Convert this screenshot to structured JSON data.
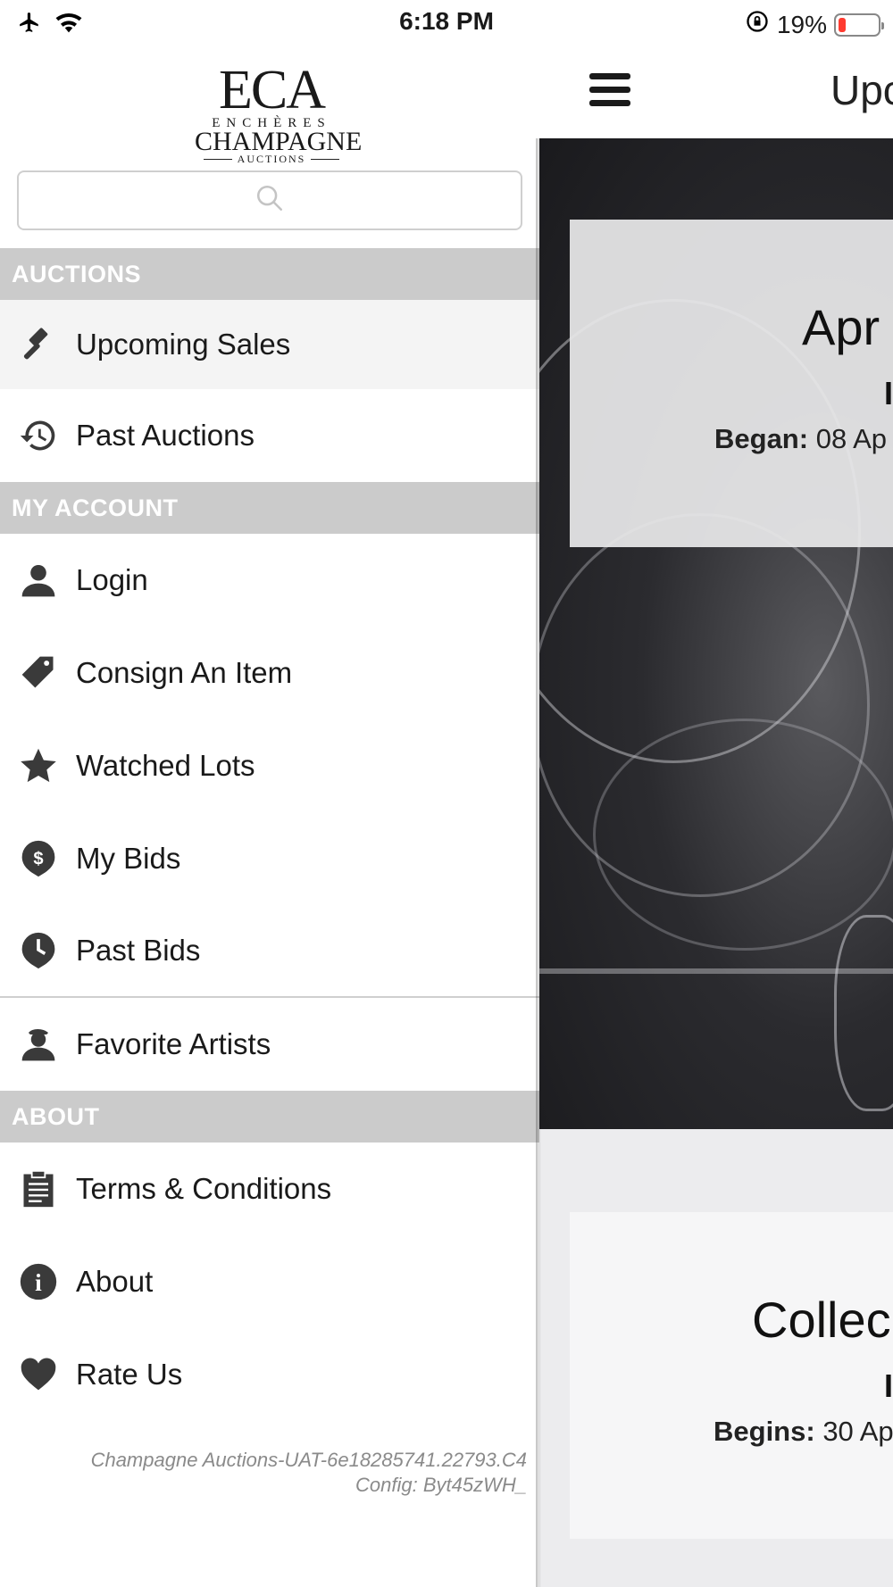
{
  "status_bar": {
    "time": "6:18 PM",
    "battery_percent": "19%",
    "battery_level": 0.19,
    "icons": [
      "airplane-icon",
      "wifi-icon",
      "orientation-lock-icon",
      "battery-icon"
    ]
  },
  "logo": {
    "monogram": "ECA",
    "line1": "ENCHÈRES",
    "line2": "CHAMPAGNE",
    "line3": "AUCTIONS"
  },
  "search": {
    "placeholder": ""
  },
  "menu": {
    "auctions_header": "AUCTIONS",
    "upcoming_sales": "Upcoming Sales",
    "past_auctions": "Past Auctions",
    "account_header": "MY ACCOUNT",
    "login": "Login",
    "consign": "Consign An Item",
    "watched_lots": "Watched Lots",
    "my_bids": "My Bids",
    "past_bids": "Past Bids",
    "favorite_artists": "Favorite Artists",
    "about_header": "ABOUT",
    "terms": "Terms & Conditions",
    "about": "About",
    "rate_us": "Rate Us"
  },
  "footer": {
    "build": "Champagne Auctions-UAT-6e18285741.22793.C4",
    "config": "Config: Byt45zWH_"
  },
  "main": {
    "header_title": "Upc",
    "card1": {
      "title": "Apr",
      "sub": "I",
      "date_label": "Began:",
      "date_value": "08 Ap"
    },
    "card2": {
      "title": "Collec",
      "sub": "I",
      "date_label": "Begins:",
      "date_value": "30 Ap"
    }
  },
  "colors": {
    "section_header_bg": "#cbcbcb",
    "active_item_bg": "#f4f4f4",
    "icon_color": "#333333",
    "battery_low": "#ff3b30"
  }
}
